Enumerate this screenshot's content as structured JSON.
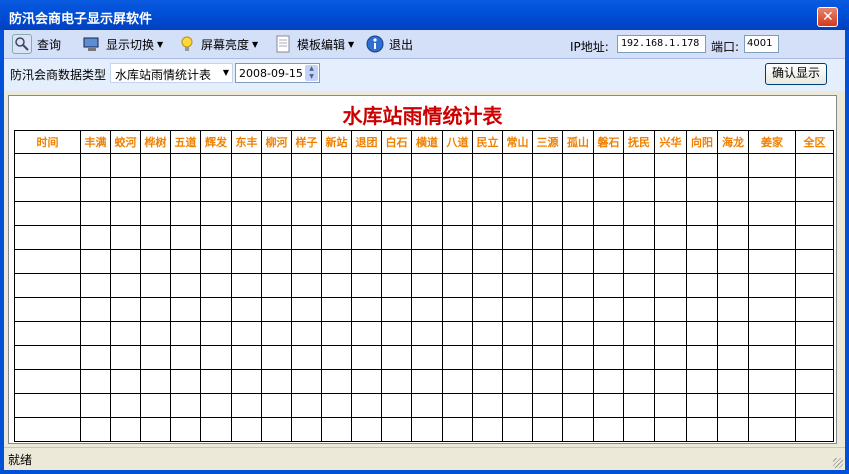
{
  "window": {
    "title": "防汛会商电子显示屏软件",
    "close_glyph": "✕"
  },
  "toolbar": {
    "query_label": "查询",
    "display_switch_label": "显示切换",
    "brightness_label": "屏幕亮度",
    "template_edit_label": "模板编辑",
    "exit_label": "退出",
    "ip_label": "IP地址:",
    "ip_value": "192.168.1.178",
    "port_label": "端口:",
    "port_value": "4001",
    "dropdown_glyph": "▼"
  },
  "filter": {
    "type_label": "防汛会商数据类型",
    "type_value": "水库站雨情统计表",
    "date_value": "2008-09-15",
    "confirm_label": "确认显示"
  },
  "table": {
    "title": "水库站雨情统计表",
    "headers": [
      "时间",
      "丰满",
      "蛟河",
      "桦树",
      "五道",
      "辉发",
      "东丰",
      "柳河",
      "样子",
      "新站",
      "退团",
      "白石",
      "横道",
      "八道",
      "民立",
      "常山",
      "三源",
      "孤山",
      "磐石",
      "抚民",
      "兴华",
      "向阳",
      "海龙",
      "姜家",
      "全区"
    ],
    "row_count": 12
  },
  "status": {
    "text": "就绪"
  },
  "colors": {
    "title_red": "#cc0000",
    "header_orange": "#f08000",
    "titlebar_blue": "#0050d8"
  },
  "icons": {
    "query": "magnifier-icon",
    "display_switch": "monitor-icon",
    "brightness": "lightbulb-icon",
    "template_edit": "document-icon",
    "exit": "exit-icon"
  }
}
